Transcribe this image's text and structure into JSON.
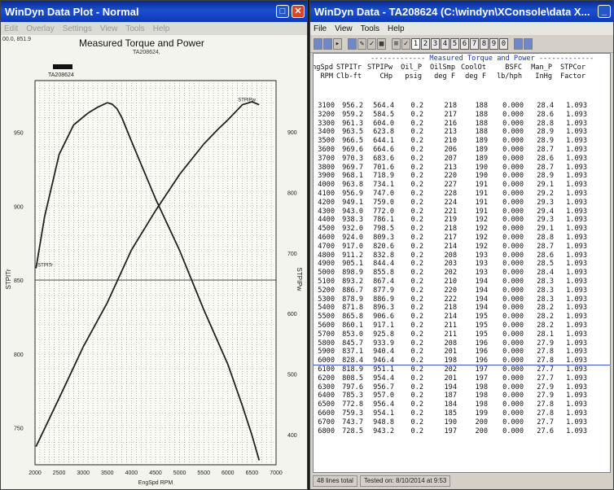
{
  "plot_window": {
    "title": "WinDyn Data Plot - Normal",
    "menu": [
      "Edit",
      "Overlay",
      "Settings",
      "View",
      "Tools",
      "Help"
    ],
    "coord_readout": "00.0, 851.9",
    "legend_label": "TA208624"
  },
  "chart_data": {
    "type": "line",
    "title": "Measured Torque and Power",
    "subtitle": "TA208624,",
    "xlabel": "EngSpd RPM",
    "ylabel_left": "STPITr",
    "ylabel_right": "STPIPw",
    "x_ticks": [
      "2000",
      "2500",
      "3000",
      "3500",
      "4000",
      "4500",
      "5000",
      "5500",
      "6000",
      "6500",
      "7000"
    ],
    "xlim": [
      2000,
      7000
    ],
    "y_left_ticks": [
      "750",
      "800",
      "850",
      "900",
      "950"
    ],
    "y_left_lim": [
      725,
      985
    ],
    "y_right_ticks": [
      "400",
      "500",
      "600",
      "700",
      "800",
      "900"
    ],
    "y_right_lim": [
      350,
      985
    ],
    "grid": true,
    "series": [
      {
        "name": "STPITr",
        "axis": "left",
        "x": [
          2020,
          2200,
          2500,
          2800,
          3100,
          3300,
          3500,
          3600,
          3700,
          3800,
          4000,
          4500,
          5000,
          5500,
          6000,
          6300,
          6500,
          6650
        ],
        "y": [
          858,
          893,
          935,
          955,
          963,
          967,
          970,
          969,
          966,
          960,
          944,
          905,
          870,
          830,
          793,
          765,
          745,
          728
        ]
      },
      {
        "name": "STPIPw",
        "axis": "right",
        "x": [
          2020,
          2500,
          3000,
          3500,
          4000,
          4500,
          5000,
          5500,
          5800,
          6000,
          6300,
          6500,
          6650
        ],
        "y": [
          380,
          460,
          545,
          618,
          705,
          770,
          830,
          880,
          905,
          920,
          945,
          950,
          945
        ]
      }
    ]
  },
  "data_window": {
    "title": "WinDyn Data - TA208624 (C:\\windyn\\XConsole\\data X...",
    "menu": [
      "File",
      "View",
      "Tools",
      "Help"
    ],
    "toolbar_numbers": [
      "1",
      "2",
      "3",
      "4",
      "5",
      "6",
      "7",
      "8",
      "9",
      "0"
    ],
    "table_title": "------------- Measured Torque and Power -------------",
    "columns": [
      {
        "h1": "EngSpd",
        "h2": "RPM"
      },
      {
        "h1": "STPITr",
        "h2": "Clb-ft"
      },
      {
        "h1": "STPIPw",
        "h2": "CHp"
      },
      {
        "h1": "Oil_P",
        "h2": "psig"
      },
      {
        "h1": "OilSmp",
        "h2": "deg F"
      },
      {
        "h1": "CoolOt",
        "h2": "deg F"
      },
      {
        "h1": "BSFC",
        "h2": "lb/hph"
      },
      {
        "h1": "Man_P",
        "h2": "InHg"
      },
      {
        "h1": "STPCor",
        "h2": "Factor"
      }
    ],
    "rows": [
      [
        "3100",
        "956.2",
        "564.4",
        "0.2",
        "218",
        "188",
        "0.000",
        "28.4",
        "1.093"
      ],
      [
        "3200",
        "959.2",
        "584.5",
        "0.2",
        "217",
        "188",
        "0.000",
        "28.6",
        "1.093"
      ],
      [
        "3300",
        "961.3",
        "604.0",
        "0.2",
        "216",
        "188",
        "0.000",
        "28.8",
        "1.093"
      ],
      [
        "3400",
        "963.5",
        "623.8",
        "0.2",
        "213",
        "188",
        "0.000",
        "28.9",
        "1.093"
      ],
      [
        "3500",
        "966.5",
        "644.1",
        "0.2",
        "210",
        "189",
        "0.000",
        "28.9",
        "1.093"
      ],
      [
        "3600",
        "969.6",
        "664.6",
        "0.2",
        "206",
        "189",
        "0.000",
        "28.7",
        "1.093"
      ],
      [
        "3700",
        "970.3",
        "683.6",
        "0.2",
        "207",
        "189",
        "0.000",
        "28.6",
        "1.093"
      ],
      [
        "3800",
        "969.7",
        "701.6",
        "0.2",
        "213",
        "190",
        "0.000",
        "28.7",
        "1.093"
      ],
      [
        "3900",
        "968.1",
        "718.9",
        "0.2",
        "220",
        "190",
        "0.000",
        "28.9",
        "1.093"
      ],
      [
        "4000",
        "963.8",
        "734.1",
        "0.2",
        "227",
        "191",
        "0.000",
        "29.1",
        "1.093"
      ],
      [
        "4100",
        "956.9",
        "747.0",
        "0.2",
        "228",
        "191",
        "0.000",
        "29.2",
        "1.093"
      ],
      [
        "4200",
        "949.1",
        "759.0",
        "0.2",
        "224",
        "191",
        "0.000",
        "29.3",
        "1.093"
      ],
      [
        "4300",
        "943.0",
        "772.0",
        "0.2",
        "221",
        "191",
        "0.000",
        "29.4",
        "1.093"
      ],
      [
        "4400",
        "938.3",
        "786.1",
        "0.2",
        "219",
        "192",
        "0.000",
        "29.3",
        "1.093"
      ],
      [
        "4500",
        "932.0",
        "798.5",
        "0.2",
        "218",
        "192",
        "0.000",
        "29.1",
        "1.093"
      ],
      [
        "4600",
        "924.0",
        "809.3",
        "0.2",
        "217",
        "192",
        "0.000",
        "28.8",
        "1.093"
      ],
      [
        "4700",
        "917.0",
        "820.6",
        "0.2",
        "214",
        "192",
        "0.000",
        "28.7",
        "1.093"
      ],
      [
        "4800",
        "911.2",
        "832.8",
        "0.2",
        "208",
        "193",
        "0.000",
        "28.6",
        "1.093"
      ],
      [
        "4900",
        "905.1",
        "844.4",
        "0.2",
        "203",
        "193",
        "0.000",
        "28.5",
        "1.093"
      ],
      [
        "5000",
        "898.9",
        "855.8",
        "0.2",
        "202",
        "193",
        "0.000",
        "28.4",
        "1.093"
      ],
      [
        "5100",
        "893.2",
        "867.4",
        "0.2",
        "210",
        "194",
        "0.000",
        "28.3",
        "1.093"
      ],
      [
        "5200",
        "886.7",
        "877.9",
        "0.2",
        "220",
        "194",
        "0.000",
        "28.3",
        "1.093"
      ],
      [
        "5300",
        "878.9",
        "886.9",
        "0.2",
        "222",
        "194",
        "0.000",
        "28.3",
        "1.093"
      ],
      [
        "5400",
        "871.8",
        "896.3",
        "0.2",
        "218",
        "194",
        "0.000",
        "28.2",
        "1.093"
      ],
      [
        "5500",
        "865.8",
        "906.6",
        "0.2",
        "214",
        "195",
        "0.000",
        "28.2",
        "1.093"
      ],
      [
        "5600",
        "860.1",
        "917.1",
        "0.2",
        "211",
        "195",
        "0.000",
        "28.2",
        "1.093"
      ],
      [
        "5700",
        "853.0",
        "925.8",
        "0.2",
        "211",
        "195",
        "0.000",
        "28.1",
        "1.093"
      ],
      [
        "5800",
        "845.7",
        "933.9",
        "0.2",
        "208",
        "196",
        "0.000",
        "27.9",
        "1.093"
      ],
      [
        "5900",
        "837.1",
        "940.4",
        "0.2",
        "201",
        "196",
        "0.000",
        "27.8",
        "1.093"
      ],
      [
        "6000",
        "828.4",
        "946.4",
        "0.2",
        "198",
        "196",
        "0.000",
        "27.8",
        "1.093"
      ],
      [
        "6100",
        "818.9",
        "951.1",
        "0.2",
        "202",
        "197",
        "0.000",
        "27.7",
        "1.093"
      ],
      [
        "6200",
        "808.5",
        "954.4",
        "0.2",
        "201",
        "197",
        "0.000",
        "27.7",
        "1.093"
      ],
      [
        "6300",
        "797.6",
        "956.7",
        "0.2",
        "194",
        "198",
        "0.000",
        "27.9",
        "1.093"
      ],
      [
        "6400",
        "785.3",
        "957.0",
        "0.2",
        "187",
        "198",
        "0.000",
        "27.9",
        "1.093"
      ],
      [
        "6500",
        "772.8",
        "956.4",
        "0.2",
        "184",
        "198",
        "0.000",
        "27.8",
        "1.093"
      ],
      [
        "6600",
        "759.3",
        "954.1",
        "0.2",
        "185",
        "199",
        "0.000",
        "27.8",
        "1.093"
      ],
      [
        "6700",
        "743.7",
        "948.8",
        "0.2",
        "190",
        "200",
        "0.000",
        "27.7",
        "1.093"
      ],
      [
        "6800",
        "728.5",
        "943.2",
        "0.2",
        "197",
        "200",
        "0.000",
        "27.6",
        "1.093"
      ]
    ],
    "status_left": "48 lines total",
    "status_right": "Tested on: 8/10/2014 at 9:53"
  },
  "colors": {
    "titlebar": "#1b4fd0",
    "curve": "#222222",
    "grid": "#555555",
    "table_title": "#1a3aa8"
  }
}
